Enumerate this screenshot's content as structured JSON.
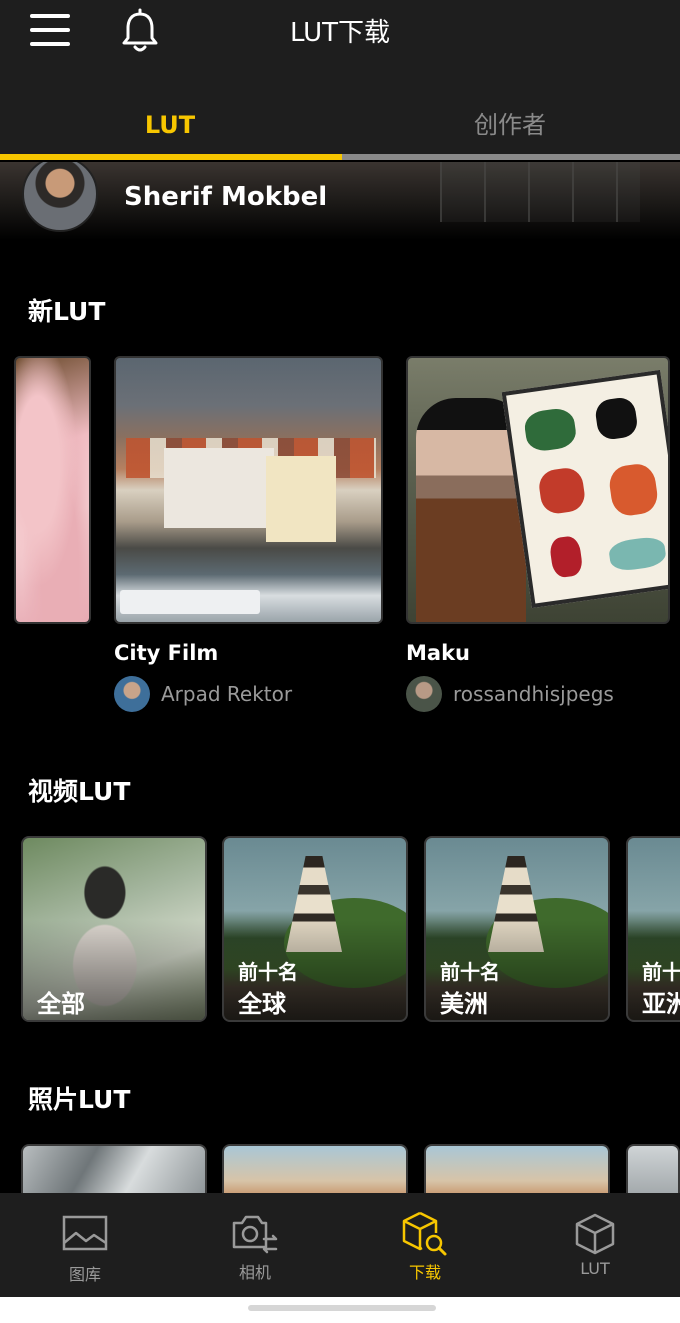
{
  "header": {
    "title": "LUT下载",
    "menu_icon": "hamburger-menu-icon",
    "bell_icon": "bell-icon"
  },
  "tabs": [
    {
      "label": "LUT",
      "active": true
    },
    {
      "label": "创作者",
      "active": false
    }
  ],
  "featured": {
    "name": "Sherif Mokbel"
  },
  "sections": {
    "new_lut": "新LUT",
    "video_lut": "视频LUT",
    "photo_lut": "照片LUT"
  },
  "new_luts": [
    {
      "name": "City Film",
      "author": "Arpad Rektor"
    },
    {
      "name": "Maku",
      "author": "rossandhisjpegs"
    }
  ],
  "video_tiles": [
    {
      "small": "",
      "big": "全部"
    },
    {
      "small": "前十名",
      "big": "全球"
    },
    {
      "small": "前十名",
      "big": "美洲"
    },
    {
      "small": "前十名",
      "big": "亚洲"
    }
  ],
  "bottom_nav": [
    {
      "label": "图库",
      "icon": "gallery-icon",
      "active": false
    },
    {
      "label": "相机",
      "icon": "camera-switch-icon",
      "active": false
    },
    {
      "label": "下载",
      "icon": "cube-search-icon",
      "active": true
    },
    {
      "label": "LUT",
      "icon": "cube-icon",
      "active": false
    }
  ],
  "colors": {
    "accent": "#f7c600",
    "header_bg": "#1e1e1e",
    "inactive_text": "#8a8a8a"
  }
}
